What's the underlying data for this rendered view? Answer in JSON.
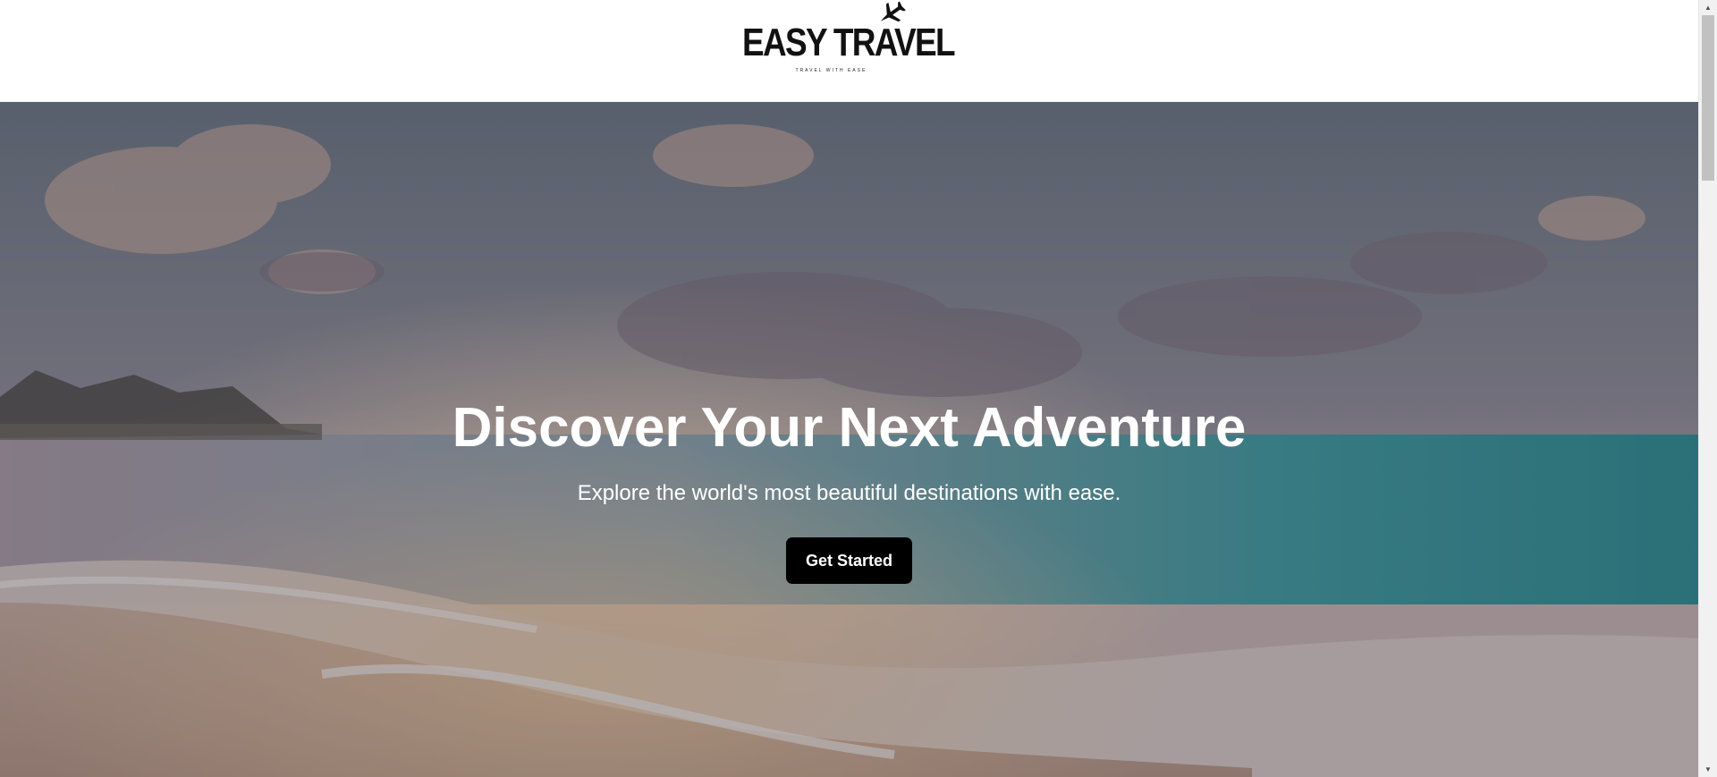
{
  "header": {
    "logo": {
      "wordmark": "EASY TRAVEL",
      "tagline": "TRAVEL WITH EASE",
      "icon": "airplane-icon"
    }
  },
  "hero": {
    "title": "Discover Your Next Adventure",
    "subtitle": "Explore the world's most beautiful destinations with ease.",
    "cta_label": "Get Started",
    "background_image": "beach-sunset-ocean",
    "overlay_color": "#282832"
  },
  "colors": {
    "header_bg": "#ffffff",
    "button_bg": "#000000",
    "button_text": "#ffffff",
    "hero_text": "#ffffff"
  },
  "scrollbar": {
    "up_icon": "scroll-up-arrow-icon",
    "down_icon": "scroll-down-arrow-icon"
  }
}
